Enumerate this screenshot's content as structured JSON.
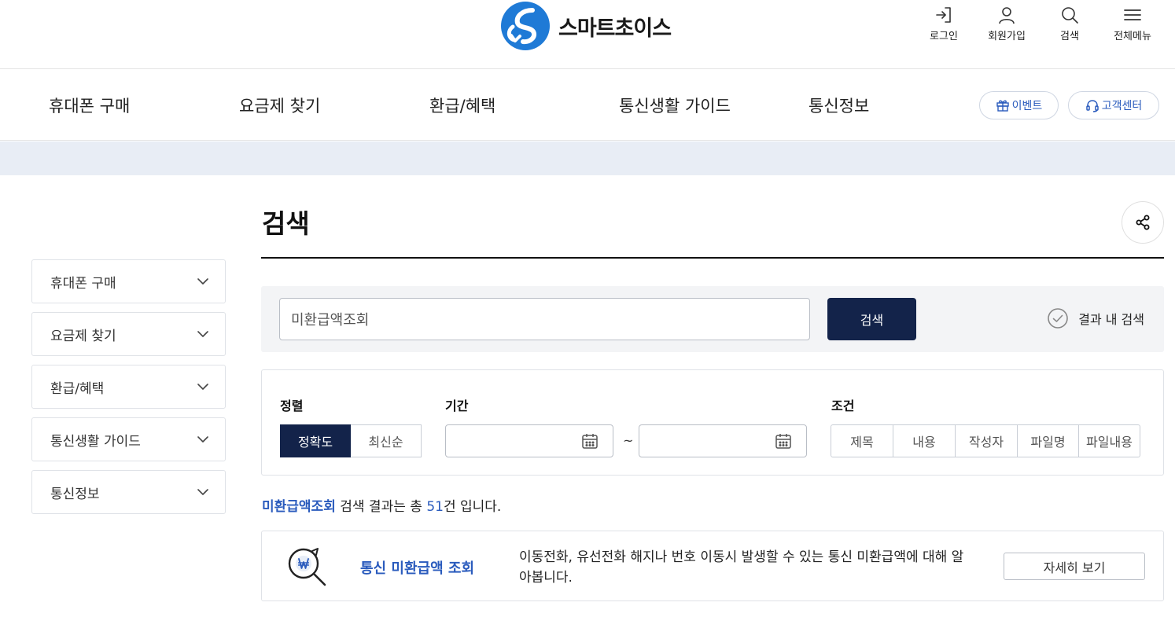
{
  "header": {
    "logo_text": "스마트초이스",
    "util": [
      {
        "label": "로그인",
        "icon": "login-icon"
      },
      {
        "label": "회원가입",
        "icon": "user-icon"
      },
      {
        "label": "검색",
        "icon": "search-icon"
      },
      {
        "label": "전체메뉴",
        "icon": "menu-icon"
      }
    ]
  },
  "gnb": {
    "items": [
      "휴대폰 구매",
      "요금제 찾기",
      "환급/혜택",
      "통신생활 가이드",
      "통신정보"
    ],
    "event_label": "이벤트",
    "support_label": "고객센터"
  },
  "sidebar": {
    "items": [
      "휴대폰 구매",
      "요금제 찾기",
      "환급/혜택",
      "통신생활 가이드",
      "통신정보"
    ]
  },
  "page": {
    "title": "검색"
  },
  "search": {
    "value": "미환급액조회",
    "button": "검색",
    "within_label": "결과 내 검색"
  },
  "filters": {
    "sort_label": "정렬",
    "sort_options": [
      "정확도",
      "최신순"
    ],
    "sort_selected": "정확도",
    "period_label": "기간",
    "period_separator": "~",
    "condition_label": "조건",
    "condition_options": [
      "제목",
      "내용",
      "작성자",
      "파일명",
      "파일내용"
    ]
  },
  "results": {
    "keyword": "미환급액조회",
    "text_before_count": " 검색 결과는 총 ",
    "count": "51",
    "text_after_count": "건 입니다.",
    "items": [
      {
        "title": "통신 미환급액 조회",
        "description": "이동전화, 유선전화 해지나 번호 이동시 발생할 수 있는 통신 미환급액에 대해 알아봅니다.",
        "button": "자세히 보기",
        "icon": "won-search-icon"
      }
    ]
  },
  "colors": {
    "brand_navy": "#13234a",
    "accent_blue": "#2a5bbd",
    "logo_blue": "#1f7ad6",
    "band": "#e8edf5"
  }
}
